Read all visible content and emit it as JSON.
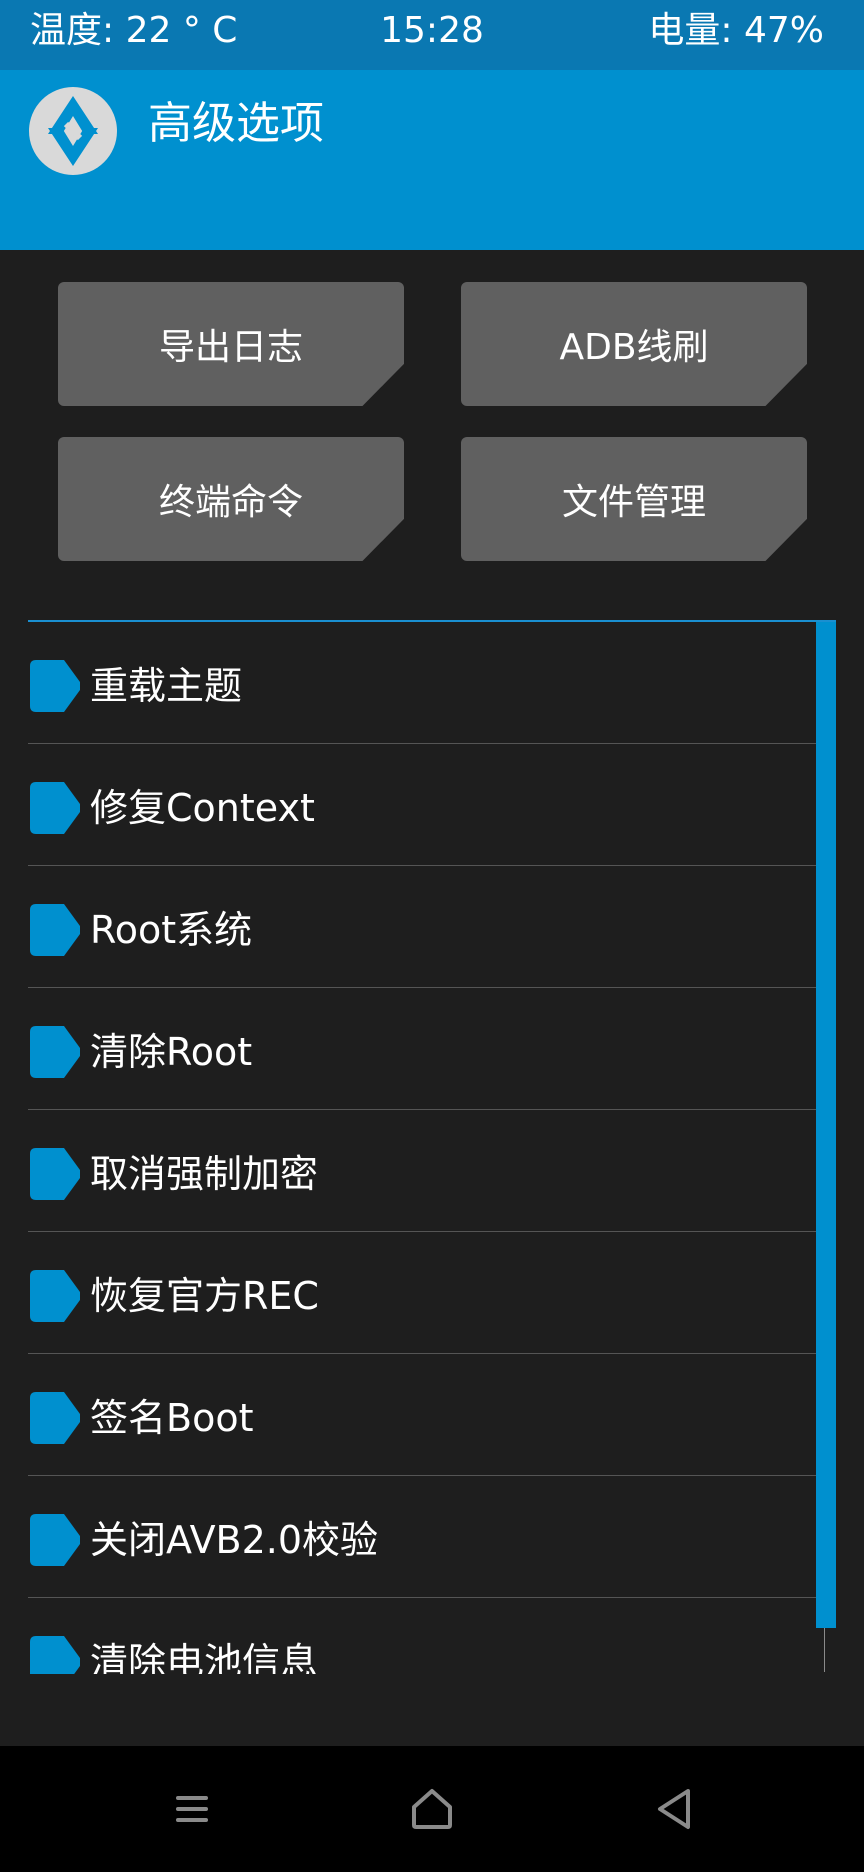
{
  "status_bar": {
    "temperature": "温度: 22 ° C",
    "time": "15:28",
    "battery": "电量: 47%"
  },
  "header": {
    "logo_icon": "twrp-logo-icon",
    "title": "高级选项"
  },
  "actions": [
    {
      "label": "导出日志"
    },
    {
      "label": "ADB线刷"
    },
    {
      "label": "终端命令"
    },
    {
      "label": "文件管理"
    }
  ],
  "list": {
    "items": [
      {
        "label": "重载主题"
      },
      {
        "label": "修复Context"
      },
      {
        "label": "Root系统"
      },
      {
        "label": "清除Root"
      },
      {
        "label": "取消强制加密"
      },
      {
        "label": "恢复官方REC"
      },
      {
        "label": "签名Boot"
      },
      {
        "label": "关闭AVB2.0校验"
      },
      {
        "label": "清除电池信息"
      }
    ]
  },
  "navbar": {
    "menu_icon": "menu-icon",
    "home_icon": "home-icon",
    "back_icon": "back-icon"
  },
  "colors": {
    "status_bar": "#0a78b2",
    "header": "#0090cf",
    "accent": "#0090cf",
    "background": "#1e1e1e",
    "button": "#606060",
    "navbar": "#000000"
  }
}
